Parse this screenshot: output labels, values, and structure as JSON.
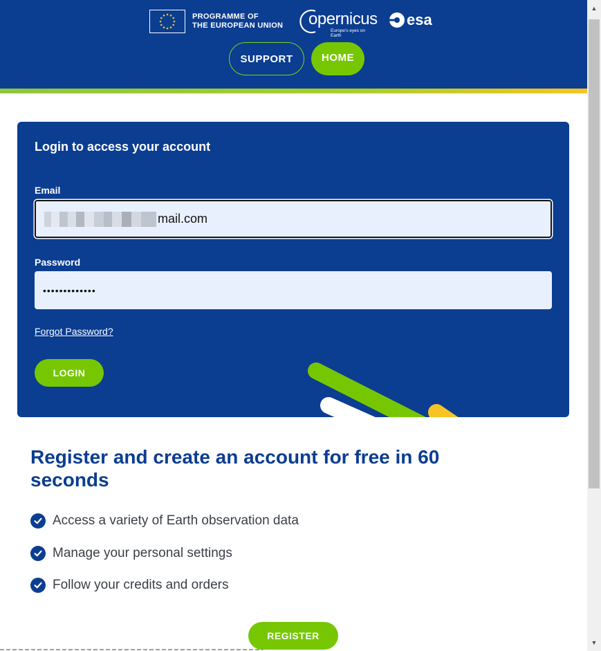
{
  "header": {
    "eu_text_line1": "PROGRAMME OF",
    "eu_text_line2": "THE EUROPEAN UNION",
    "copernicus_word": "opernicus",
    "copernicus_tagline": "Europe's eyes on Earth",
    "esa_word": "esa",
    "nav": {
      "support_label": "SUPPORT",
      "home_label": "HOME"
    },
    "brand_colors": {
      "primary": "#0b3d91",
      "accent_green": "#76c702",
      "accent_yellow": "#f6c425"
    }
  },
  "login": {
    "title": "Login to access your account",
    "email_label": "Email",
    "email_value_visible": "mail.com",
    "password_label": "Password",
    "password_value": "•••••••••••••",
    "forgot_label": "Forgot Password?",
    "login_button": "LOGIN"
  },
  "register": {
    "title": "Register and create an account for free in 60 seconds",
    "benefits": [
      "Access a variety of Earth observation data",
      "Manage your personal settings",
      "Follow your credits and orders"
    ],
    "register_button": "REGISTER"
  }
}
